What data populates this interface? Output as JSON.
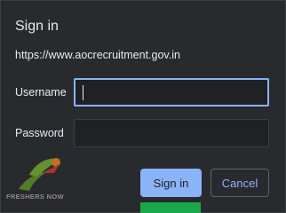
{
  "dialog": {
    "title": "Sign in",
    "url": "https://www.aocrecruitment.gov.in",
    "username_label": "Username",
    "password_label": "Password",
    "username_value": "",
    "password_value": "",
    "signin_label": "Sign in",
    "cancel_label": "Cancel"
  },
  "watermark": {
    "text": "FRESHERS NOW"
  },
  "colors": {
    "dialog_bg": "#292a2d",
    "accent": "#8ab4f8",
    "text": "#e8eaed"
  }
}
